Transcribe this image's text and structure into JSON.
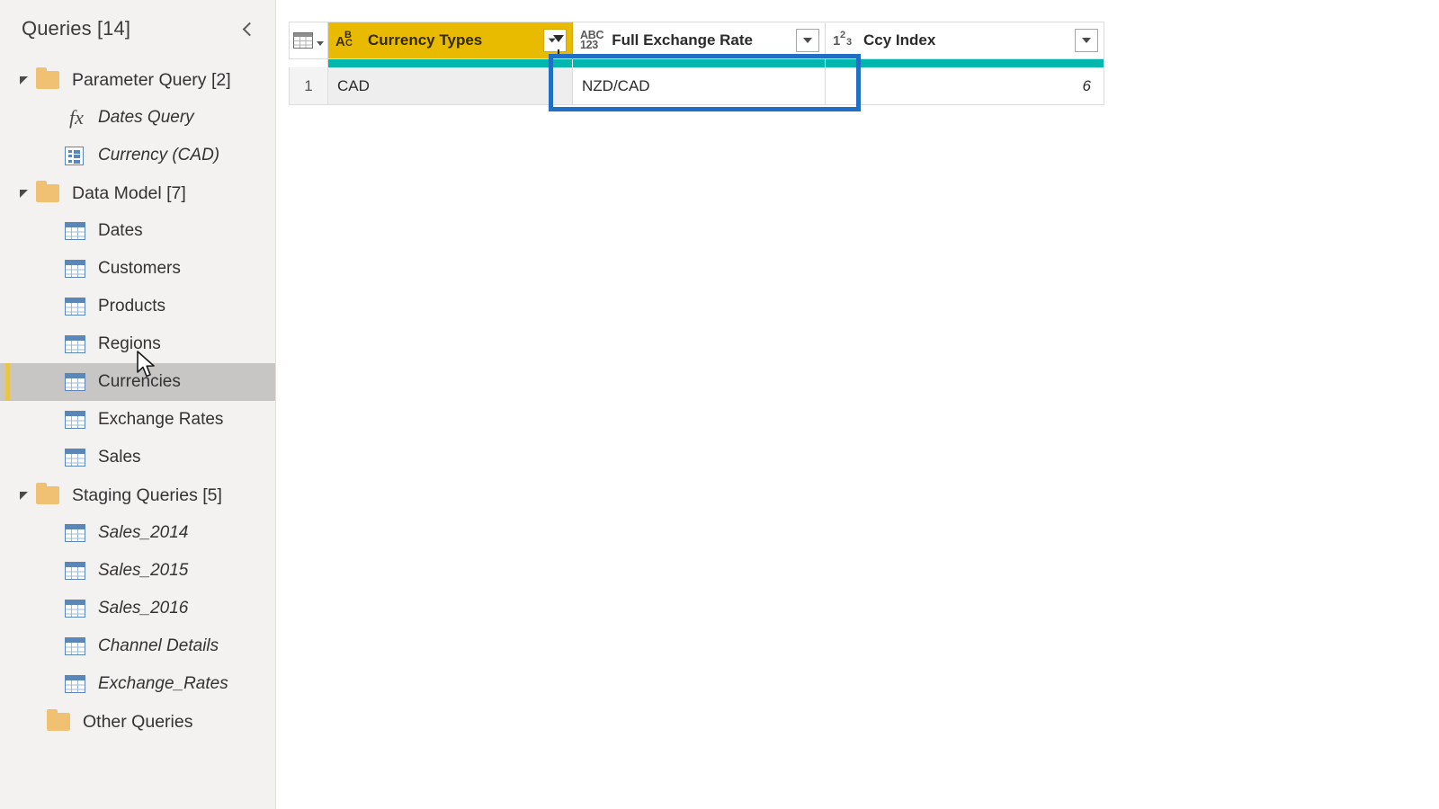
{
  "sidebar": {
    "title": "Queries [14]",
    "collapse_icon": "chevron-left-icon",
    "groups": [
      {
        "label": "Parameter Query [2]",
        "expanded": true,
        "icon": "folder-icon",
        "items": [
          {
            "label": "Dates Query",
            "icon": "fx-icon",
            "italic": true
          },
          {
            "label": "Currency (CAD)",
            "icon": "parameter-icon",
            "italic": true
          }
        ]
      },
      {
        "label": "Data Model [7]",
        "expanded": true,
        "icon": "folder-icon",
        "items": [
          {
            "label": "Dates",
            "icon": "table-icon",
            "italic": false,
            "selected": false
          },
          {
            "label": "Customers",
            "icon": "table-icon",
            "italic": false,
            "selected": false
          },
          {
            "label": "Products",
            "icon": "table-icon",
            "italic": false,
            "selected": false
          },
          {
            "label": "Regions",
            "icon": "table-icon",
            "italic": false,
            "selected": false
          },
          {
            "label": "Currencies",
            "icon": "table-icon",
            "italic": false,
            "selected": true
          },
          {
            "label": "Exchange Rates",
            "icon": "table-icon",
            "italic": false,
            "selected": false
          },
          {
            "label": "Sales",
            "icon": "table-icon",
            "italic": false,
            "selected": false
          }
        ]
      },
      {
        "label": "Staging Queries [5]",
        "expanded": true,
        "icon": "folder-icon",
        "items": [
          {
            "label": "Sales_2014",
            "icon": "table-icon",
            "italic": true
          },
          {
            "label": "Sales_2015",
            "icon": "table-icon",
            "italic": true
          },
          {
            "label": "Sales_2016",
            "icon": "table-icon",
            "italic": true
          },
          {
            "label": "Channel Details",
            "icon": "table-icon",
            "italic": true
          },
          {
            "label": "Exchange_Rates",
            "icon": "table-icon",
            "italic": true
          }
        ]
      },
      {
        "label": "Other Queries",
        "expanded": false,
        "icon": "folder-icon",
        "items": []
      }
    ]
  },
  "grid": {
    "corner_icon": "select-all-table-icon",
    "columns": [
      {
        "header": "Currency Types",
        "type_icon": "text-type-icon",
        "type_glyph": {
          "a": "A",
          "b": "B",
          "c": "C"
        },
        "filtered": true,
        "highlighted": true,
        "button_icon": "filter-applied-icon",
        "quality": "valid"
      },
      {
        "header": "Full Exchange Rate",
        "type_icon": "any-type-icon",
        "type_glyph": {
          "top": "ABC",
          "bottom": "123"
        },
        "filtered": false,
        "highlighted": false,
        "button_icon": "chevron-down-icon",
        "quality": "valid"
      },
      {
        "header": "Ccy Index",
        "type_icon": "whole-number-type-icon",
        "type_glyph": {
          "n1": "1",
          "n2": "2",
          "n3": "3"
        },
        "filtered": false,
        "highlighted": false,
        "button_icon": "chevron-down-icon",
        "quality": "valid"
      }
    ],
    "rows": [
      {
        "number": "1",
        "Currency Types": "CAD",
        "Full Exchange Rate": "NZD/CAD",
        "Ccy Index": "6"
      }
    ]
  },
  "annotation": {
    "highlight_box_color": "#1f6fc4",
    "accent_selected_color": "#e8c449",
    "header_filter_color": "#e9bb00",
    "quality_bar_color": "#00b7ae"
  },
  "cursor": {
    "icon": "mouse-pointer-icon"
  }
}
